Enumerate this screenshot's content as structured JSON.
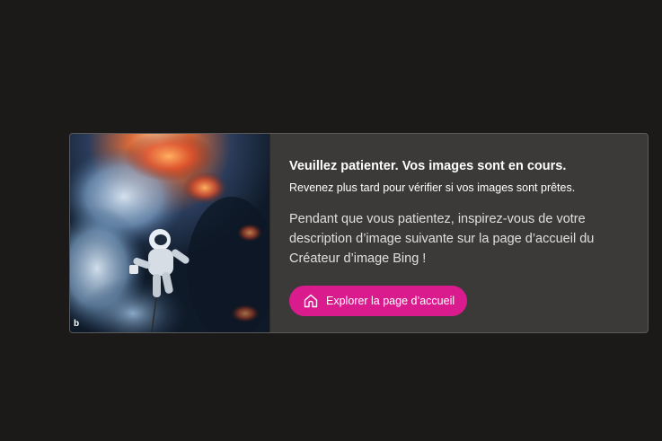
{
  "card": {
    "thumbnail_watermark": "b",
    "title": "Veuillez patienter. Vos images sont en cours.",
    "subtitle": "Revenez plus tard pour vérifier si vos images sont prêtes.",
    "description": "Pendant que vous patientez, inspirez-vous de votre description d’image suivante sur la page d’accueil du Créateur d’image Bing !",
    "button": {
      "label": "Explorer la page d’accueil",
      "icon": "home-icon"
    }
  },
  "colors": {
    "page_background": "#1b1a19",
    "card_background": "#3b3a39",
    "accent": "#da1b8e"
  }
}
